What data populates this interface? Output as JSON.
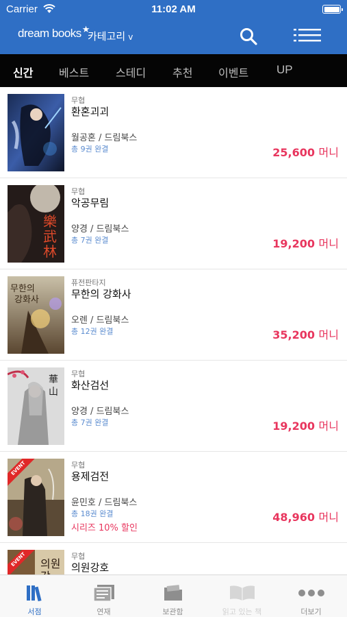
{
  "status_bar": {
    "carrier": "Carrier",
    "time": "11:02 AM"
  },
  "nav": {
    "logo": "dream books",
    "category": "카테고리",
    "category_chevron": "v"
  },
  "tabs": [
    {
      "label": "신간",
      "active": true
    },
    {
      "label": "베스트",
      "active": false
    },
    {
      "label": "스테디",
      "active": false
    },
    {
      "label": "추천",
      "active": false
    },
    {
      "label": "이벤트",
      "active": false
    },
    {
      "label": "UP",
      "active": false
    }
  ],
  "books": [
    {
      "genre": "무협",
      "title": "환혼괴괴",
      "author": "월공혼 / 드림북스",
      "volumes": "총 9권 완결",
      "price": "25,600",
      "price_unit": "머니",
      "promo": "",
      "event": false
    },
    {
      "genre": "무협",
      "title": "악공무림",
      "author": "양경 / 드림북스",
      "volumes": "총 7권 완결",
      "price": "19,200",
      "price_unit": "머니",
      "promo": "",
      "event": false
    },
    {
      "genre": "퓨전판타지",
      "title": "무한의 강화사",
      "author": "오렌 / 드림북스",
      "volumes": "총 12권 완결",
      "price": "35,200",
      "price_unit": "머니",
      "promo": "",
      "event": false
    },
    {
      "genre": "무협",
      "title": "화산검선",
      "author": "양경 / 드림북스",
      "volumes": "총 7권 완결",
      "price": "19,200",
      "price_unit": "머니",
      "promo": "",
      "event": false
    },
    {
      "genre": "무협",
      "title": "용제검전",
      "author": "윤민호 / 드림북스",
      "volumes": "총 18권 완결",
      "price": "48,960",
      "price_unit": "머니",
      "promo": "시리즈 10% 할인",
      "event": true,
      "event_label": "EVENT"
    },
    {
      "genre": "무협",
      "title": "의원강호",
      "author": "",
      "volumes": "",
      "price": "",
      "price_unit": "",
      "promo": "",
      "event": true,
      "event_label": "EVENT"
    }
  ],
  "bottom_tabs": [
    {
      "label": "서점",
      "icon": "books-icon",
      "state": "active"
    },
    {
      "label": "연재",
      "icon": "news-icon",
      "state": "normal"
    },
    {
      "label": "보관함",
      "icon": "folder-icon",
      "state": "normal"
    },
    {
      "label": "읽고 있는 책",
      "icon": "open-book-icon",
      "state": "disabled"
    },
    {
      "label": "더보기",
      "icon": "more-icon",
      "state": "normal"
    }
  ],
  "colors": {
    "header": "#2f6fc5",
    "tabbar": "#050505",
    "price": "#e8365e",
    "volumes": "#5a8bcf",
    "active_tab": "#2f6fc5"
  }
}
